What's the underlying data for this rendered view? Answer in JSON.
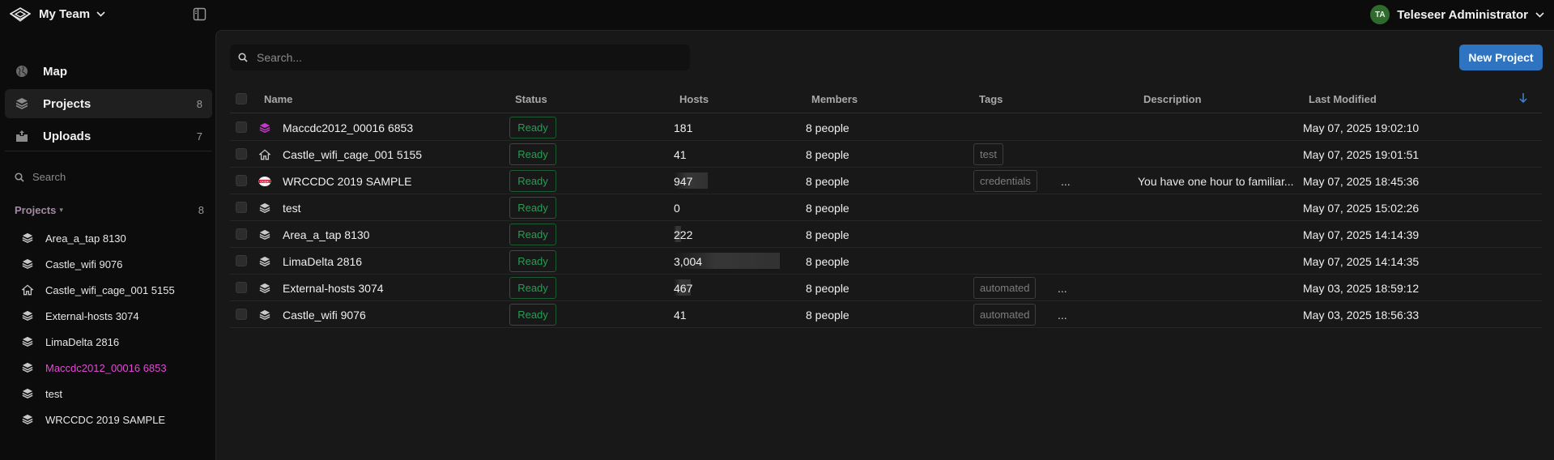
{
  "topbar": {
    "team_name": "My Team",
    "user_initials": "TA",
    "user_name": "Teleseer Administrator",
    "avatar_color": "#2e6b2c"
  },
  "sidebar": {
    "nav": [
      {
        "label": "Map",
        "icon": "globe-icon",
        "count": ""
      },
      {
        "label": "Projects",
        "icon": "layers-icon",
        "count": "8",
        "active": true
      },
      {
        "label": "Uploads",
        "icon": "upload-box-icon",
        "count": "7"
      }
    ],
    "search_placeholder": "Search",
    "projects_heading": "Projects",
    "projects_count": "8",
    "projects": [
      {
        "label": "Area_a_tap 8130",
        "icon": "layers-icon"
      },
      {
        "label": "Castle_wifi 9076",
        "icon": "layers-icon"
      },
      {
        "label": "Castle_wifi_cage_001 5155",
        "icon": "home-icon"
      },
      {
        "label": "External-hosts 3074",
        "icon": "layers-icon"
      },
      {
        "label": "LimaDelta 2816",
        "icon": "layers-icon"
      },
      {
        "label": "Maccdc2012_00016 6853",
        "icon": "layers-icon",
        "active": true
      },
      {
        "label": "test",
        "icon": "layers-icon"
      },
      {
        "label": "WRCCDC 2019 SAMPLE",
        "icon": "layers-icon"
      }
    ]
  },
  "main": {
    "search_placeholder": "Search...",
    "new_project_label": "New Project",
    "accent_color": "#2e74c0",
    "columns": {
      "name": "Name",
      "status": "Status",
      "hosts": "Hosts",
      "members": "Members",
      "tags": "Tags",
      "description": "Description",
      "last_modified": "Last Modified"
    },
    "rows": [
      {
        "name": "Maccdc2012_00016 6853",
        "icon": "layers-icon",
        "status": "Ready",
        "hosts": "181",
        "hosts_bar": 0,
        "members": "8 people",
        "tag": "",
        "more": "",
        "description": "",
        "modified": "May 07, 2025 19:02:10"
      },
      {
        "name": "Castle_wifi_cage_001 5155",
        "icon": "home-icon",
        "status": "Ready",
        "hosts": "41",
        "hosts_bar": 0,
        "members": "8 people",
        "tag": "test",
        "more": "",
        "description": "",
        "modified": "May 07, 2025 19:01:51"
      },
      {
        "name": "WRCCDC 2019 SAMPLE",
        "icon": "ccdc-logo-icon",
        "status": "Ready",
        "hosts": "947",
        "hosts_bar": 0.32,
        "members": "8 people",
        "tag": "credentials",
        "more": "...",
        "description": "You have one hour to familiar...",
        "modified": "May 07, 2025 18:45:36"
      },
      {
        "name": "test",
        "icon": "layers-icon",
        "status": "Ready",
        "hosts": "0",
        "hosts_bar": 0,
        "members": "8 people",
        "tag": "",
        "more": "",
        "description": "",
        "modified": "May 07, 2025 15:02:26"
      },
      {
        "name": "Area_a_tap 8130",
        "icon": "layers-icon",
        "status": "Ready",
        "hosts": "222",
        "hosts_bar": 0.07,
        "members": "8 people",
        "tag": "",
        "more": "",
        "description": "",
        "modified": "May 07, 2025 14:14:39"
      },
      {
        "name": "LimaDelta 2816",
        "icon": "layers-icon",
        "status": "Ready",
        "hosts": "3,004",
        "hosts_bar": 1.0,
        "members": "8 people",
        "tag": "",
        "more": "",
        "description": "",
        "modified": "May 07, 2025 14:14:35"
      },
      {
        "name": "External-hosts 3074",
        "icon": "layers-icon",
        "status": "Ready",
        "hosts": "467",
        "hosts_bar": 0.16,
        "members": "8 people",
        "tag": "automated",
        "more": "...",
        "description": "",
        "modified": "May 03, 2025 18:59:12"
      },
      {
        "name": "Castle_wifi 9076",
        "icon": "layers-icon",
        "status": "Ready",
        "hosts": "41",
        "hosts_bar": 0,
        "members": "8 people",
        "tag": "automated",
        "more": "...",
        "description": "",
        "modified": "May 03, 2025 18:56:33"
      }
    ]
  }
}
